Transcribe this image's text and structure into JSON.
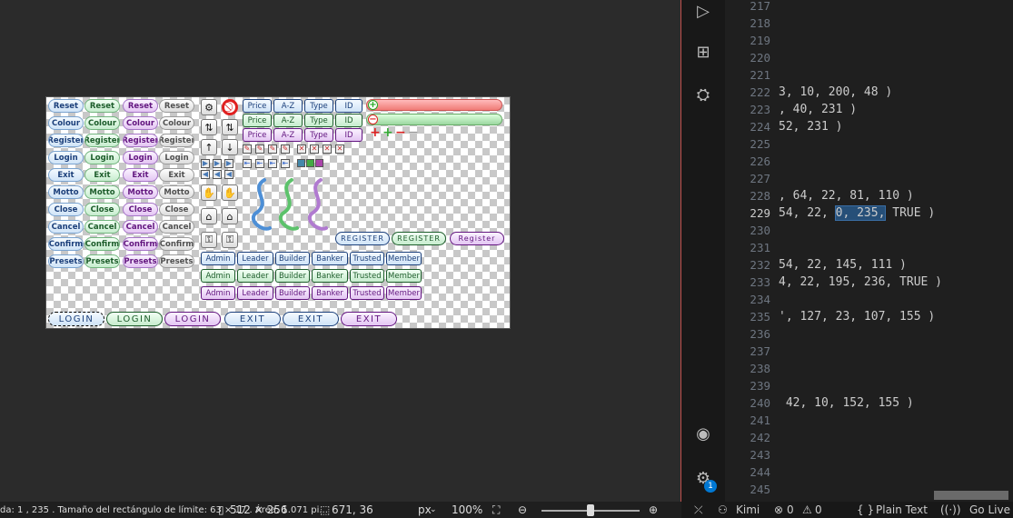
{
  "sprite": {
    "rows": [
      "Reset",
      "Colour",
      "Register",
      "Login",
      "Exit",
      "Motto",
      "Close",
      "Cancel",
      "Confirm",
      "Presets"
    ],
    "sort": [
      "Price",
      "A-Z",
      "Type",
      "ID"
    ],
    "roles": [
      "Admin",
      "Leader",
      "Builder",
      "Banker",
      "Trusted",
      "Member"
    ],
    "register": "REGISTER",
    "register_alt": "Register",
    "login": "LOGIN",
    "exit": "EXIT",
    "colors": {
      "blue": "#cfe3f7",
      "green": "#c6eccd",
      "purple": "#e3c5f3",
      "gray": "#dcdcdc",
      "red_bar": "#f48a85",
      "green_bar": "#9bd7a0"
    }
  },
  "viewer_status": {
    "selection": "da: 1 , 235 . Tamaño del rectángulo de límite: 63 × 17 . Área: 1.071 pi...",
    "image_size": "512 × 256",
    "cursor": "671, 36",
    "unit": "px",
    "zoom": "100%"
  },
  "editor": {
    "lines": [
      {
        "num": "217",
        "code": ""
      },
      {
        "num": "218",
        "code": ""
      },
      {
        "num": "219",
        "code": ""
      },
      {
        "num": "220",
        "code": ""
      },
      {
        "num": "221",
        "code": ""
      },
      {
        "num": "222",
        "code": "3, 10, 200, 48 )"
      },
      {
        "num": "223",
        "code": ", 40, 231 )"
      },
      {
        "num": "224",
        "code": "52, 231 )"
      },
      {
        "num": "225",
        "code": ""
      },
      {
        "num": "226",
        "code": ""
      },
      {
        "num": "227",
        "code": ""
      },
      {
        "num": "228",
        "code": ", 64, 22, 81, 110 )"
      },
      {
        "num": "229",
        "code": "54, 22, "
      },
      {
        "num": "230",
        "code": ""
      },
      {
        "num": "231",
        "code": ""
      },
      {
        "num": "232",
        "code": "54, 22, 145, 111 )"
      },
      {
        "num": "233",
        "code": "4, 22, 195, 236, TRUE )"
      },
      {
        "num": "234",
        "code": ""
      },
      {
        "num": "235",
        "code": "', 127, 23, 107, 155 )"
      },
      {
        "num": "236",
        "code": ""
      },
      {
        "num": "237",
        "code": ""
      },
      {
        "num": "238",
        "code": ""
      },
      {
        "num": "239",
        "code": ""
      },
      {
        "num": "240",
        "code": " 42, 10, 152, 155 )"
      },
      {
        "num": "241",
        "code": ""
      },
      {
        "num": "242",
        "code": ""
      },
      {
        "num": "243",
        "code": ""
      },
      {
        "num": "244",
        "code": ""
      },
      {
        "num": "245",
        "code": ""
      }
    ],
    "selected_text": "0, 235,",
    "after_selection": " TRUE )",
    "current_line": "229"
  },
  "vscode_status": {
    "kimi": "Kimi",
    "problems": "0",
    "warnings": "0",
    "language": "Plain Text",
    "golive": "Go Live",
    "notif_badge": "1"
  }
}
